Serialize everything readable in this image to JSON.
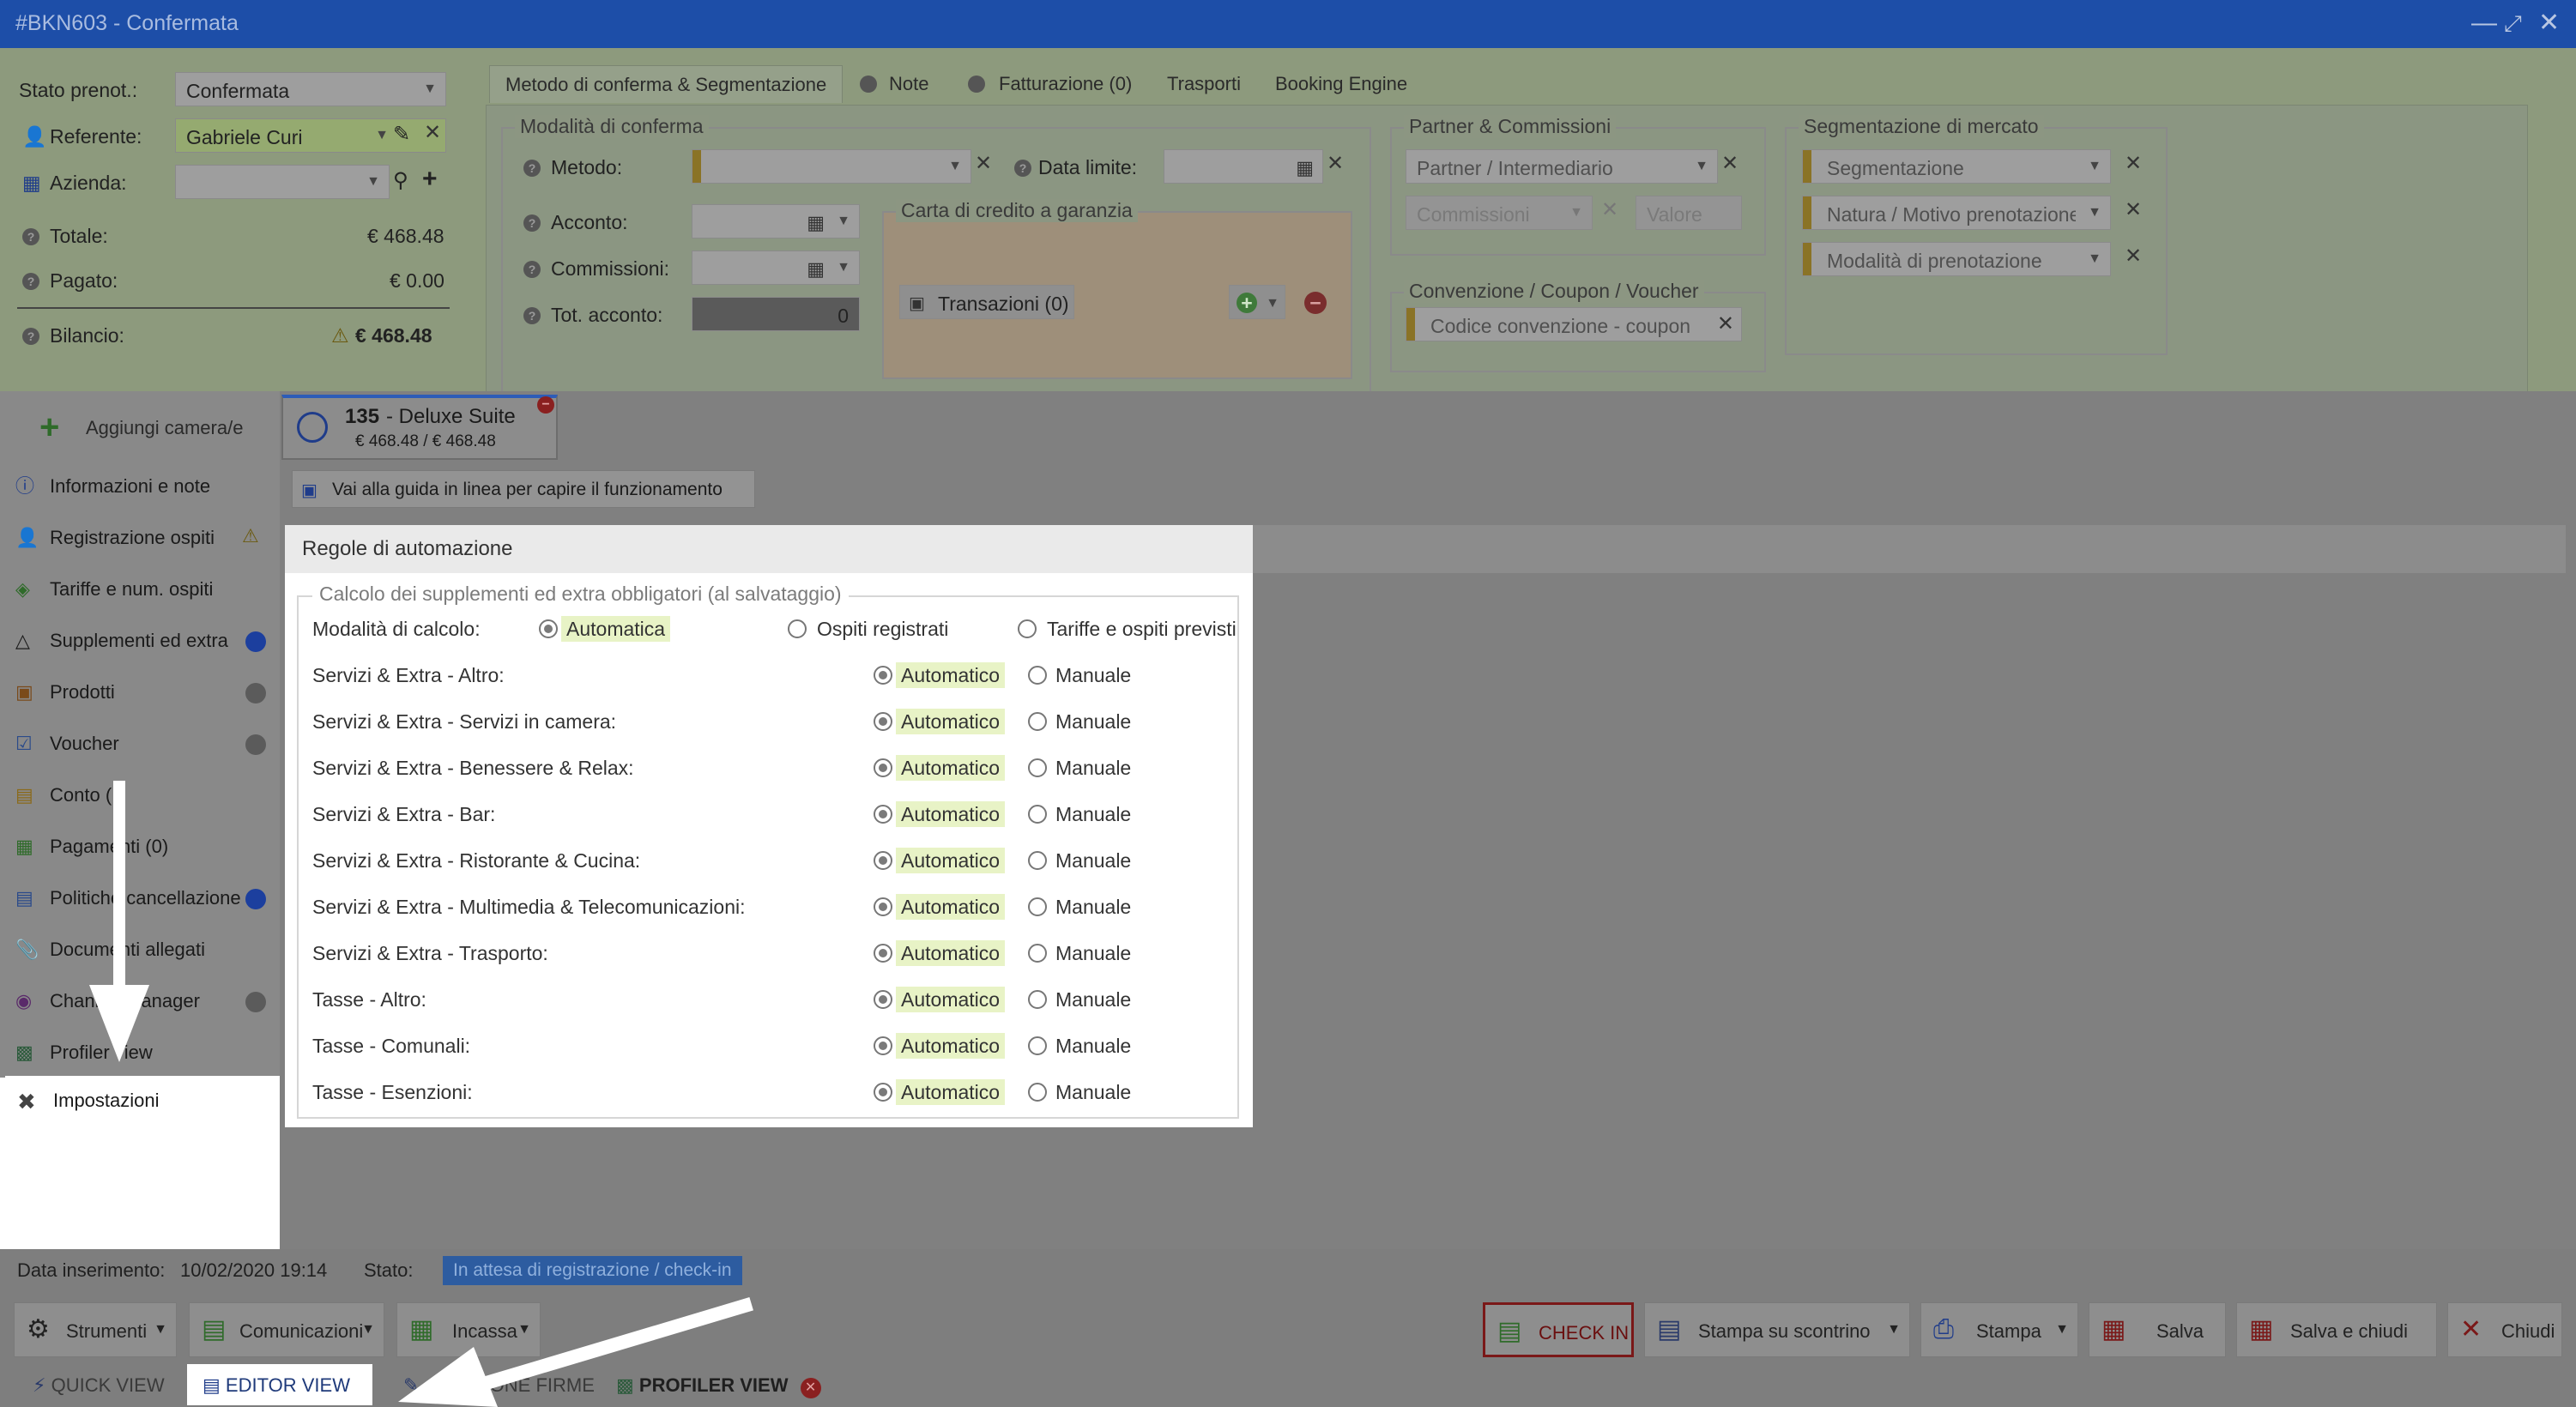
{
  "window": {
    "title": "#BKN603 - Confermata"
  },
  "booking": {
    "status_label": "Stato prenot.:",
    "status_value": "Confermata",
    "referent_label": "Referente:",
    "referent_value": "Gabriele Curi",
    "company_label": "Azienda:",
    "company_value": "",
    "total_label": "Totale:",
    "total_value": "€ 468.48",
    "paid_label": "Pagato:",
    "paid_value": "€ 0.00",
    "balance_label": "Bilancio:",
    "balance_value": "€ 468.48"
  },
  "top_tabs": [
    {
      "label": "Metodo di conferma & Segmentazione"
    },
    {
      "label": "Note"
    },
    {
      "label": "Fatturazione (0)"
    },
    {
      "label": "Trasporti"
    },
    {
      "label": "Booking Engine"
    }
  ],
  "confirm": {
    "legend": "Modalità di conferma",
    "method_label": "Metodo:",
    "deadline_label": "Data limite:",
    "deposit_label": "Acconto:",
    "commission_label": "Commissioni:",
    "tot_deposit_label": "Tot. acconto:",
    "tot_deposit_value": "0",
    "card_legend": "Carta di credito a garanzia",
    "transactions_label": "Transazioni (0)"
  },
  "partner": {
    "legend": "Partner & Commissioni",
    "partner_placeholder": "Partner / Intermediario",
    "commission_placeholder": "Commissioni",
    "value_placeholder": "Valore"
  },
  "voucher": {
    "legend": "Convenzione / Coupon / Voucher",
    "code_placeholder": "Codice convenzione - coupon"
  },
  "segmentation": {
    "legend": "Segmentazione di mercato",
    "segment_placeholder": "Segmentazione",
    "reason_placeholder": "Natura / Motivo prenotazione",
    "mode_placeholder": "Modalità di prenotazione"
  },
  "sidebar": {
    "add_room": "Aggiungi camera/e",
    "items": [
      {
        "label": "Informazioni e note"
      },
      {
        "label": "Registrazione ospiti"
      },
      {
        "label": "Tariffe e num. ospiti"
      },
      {
        "label": "Supplementi ed extra"
      },
      {
        "label": "Prodotti"
      },
      {
        "label": "Voucher"
      },
      {
        "label": "Conto ("
      },
      {
        "label": "Pagamenti (0)"
      },
      {
        "label": "Politiche cancellazione"
      },
      {
        "label": "Documenti allegati"
      },
      {
        "label": "Channel manager"
      },
      {
        "label": "Profiler view"
      }
    ],
    "selected": "Impostazioni"
  },
  "room_tab": {
    "number": "135",
    "name": "- Deluxe Suite",
    "amount": "€ 468.48 / € 468.48"
  },
  "guide_link": "Vai alla guida in linea per capire il funzionamento",
  "automation": {
    "title": "Regole di automazione",
    "legend": "Calcolo dei supplementi ed extra obbligatori (al salvataggio)",
    "mode_label": "Modalità di calcolo:",
    "mode_options": [
      "Automatica",
      "Ospiti registrati",
      "Tariffe e ospiti previsti"
    ],
    "auto_label": "Automatico",
    "manual_label": "Manuale",
    "rules": [
      {
        "name": "Servizi & Extra - Altro:"
      },
      {
        "name": "Servizi & Extra - Servizi in camera:"
      },
      {
        "name": "Servizi & Extra - Benessere & Relax:"
      },
      {
        "name": "Servizi & Extra - Bar:"
      },
      {
        "name": "Servizi & Extra - Ristorante & Cucina:"
      },
      {
        "name": "Servizi & Extra - Multimedia & Telecomunicazioni:"
      },
      {
        "name": "Servizi & Extra - Trasporto:"
      },
      {
        "name": "Tasse - Altro:"
      },
      {
        "name": "Tasse - Comunali:"
      },
      {
        "name": "Tasse - Esenzioni:"
      }
    ]
  },
  "status_bar": {
    "inserted_label": "Data inserimento:",
    "inserted_value": "10/02/2020 19:14",
    "state_label": "Stato:",
    "state_value": "In attesa di registrazione / check-in"
  },
  "toolbar": {
    "tools": "Strumenti",
    "communications": "Comunicazioni",
    "collect": "Incassa",
    "checkin": "CHECK IN",
    "print_receipt": "Stampa su scontrino",
    "print": "Stampa",
    "save": "Salva",
    "save_close": "Salva e chiudi",
    "close": "Chiudi"
  },
  "view_tabs": {
    "quick": "QUICK VIEW",
    "editor": "EDITOR VIEW",
    "signatures": "IONE FIRME",
    "profiler": "PROFILER VIEW"
  },
  "colors": {
    "accent": "#1d4ea8",
    "selection": "#e8f3c6",
    "highlight": "#ffffff"
  }
}
